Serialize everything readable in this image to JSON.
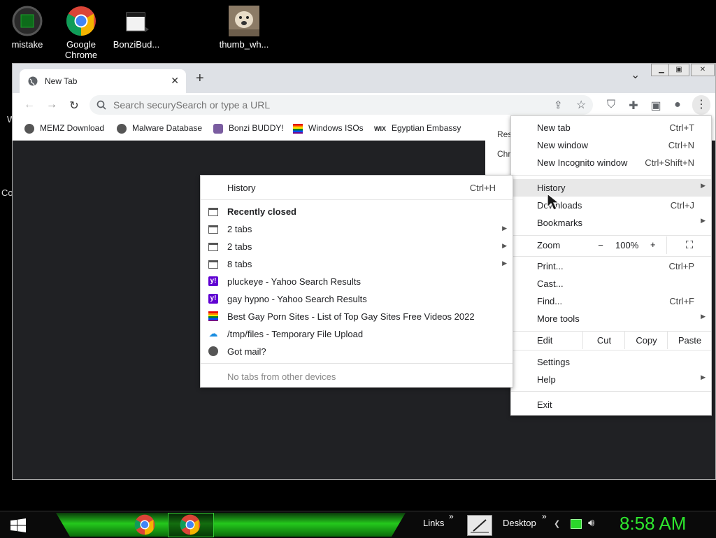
{
  "desktop": {
    "icons": [
      {
        "label": "mistake"
      },
      {
        "label": "Google Chrome"
      },
      {
        "label": "BonziBud..."
      },
      {
        "label": "thumb_wh..."
      }
    ],
    "edge_texts": [
      "W",
      "Co"
    ]
  },
  "browser": {
    "tab_title": "New Tab",
    "close_symbol": "✕",
    "new_tab_symbol": "+",
    "tab_dropdown_symbol": "⌄",
    "omnibox_placeholder": "Search securySearch or type a URL",
    "bookmarks": [
      {
        "label": "MEMZ Download",
        "icon": "globe-icon"
      },
      {
        "label": "Malware Database",
        "icon": "globe-icon"
      },
      {
        "label": "Bonzi BUDDY!",
        "icon": "bonzi-icon"
      },
      {
        "label": "Windows ISOs",
        "icon": "rainbow-icon"
      },
      {
        "label": "Egyptian Embassy",
        "icon": "wix-icon",
        "icon_text": "WIX"
      }
    ],
    "partial_menu": [
      "Res",
      "Chr"
    ]
  },
  "main_menu": {
    "items": [
      {
        "label": "New tab",
        "shortcut": "Ctrl+T"
      },
      {
        "label": "New window",
        "shortcut": "Ctrl+N"
      },
      {
        "label": "New Incognito window",
        "shortcut": "Ctrl+Shift+N"
      },
      {
        "label": "History",
        "shortcut": ""
      },
      {
        "label": "Downloads",
        "shortcut": "Ctrl+J"
      },
      {
        "label": "Bookmarks",
        "shortcut": ""
      },
      {
        "label": "Print...",
        "shortcut": "Ctrl+P"
      },
      {
        "label": "Cast...",
        "shortcut": ""
      },
      {
        "label": "Find...",
        "shortcut": "Ctrl+F"
      },
      {
        "label": "More tools",
        "shortcut": ""
      },
      {
        "label": "Settings",
        "shortcut": ""
      },
      {
        "label": "Help",
        "shortcut": ""
      },
      {
        "label": "Exit",
        "shortcut": ""
      }
    ],
    "zoom": {
      "label": "Zoom",
      "minus": "−",
      "value": "100%",
      "plus": "+"
    },
    "edit": {
      "label": "Edit",
      "cut": "Cut",
      "copy": "Copy",
      "paste": "Paste"
    }
  },
  "history_menu": {
    "header": {
      "label": "History",
      "shortcut": "Ctrl+H"
    },
    "recently_closed": "Recently closed",
    "items": [
      {
        "label": "2 tabs",
        "icon": "tab-group-icon"
      },
      {
        "label": "2 tabs",
        "icon": "tab-group-icon"
      },
      {
        "label": "8 tabs",
        "icon": "tab-group-icon"
      },
      {
        "label": "pluckeye - Yahoo Search Results",
        "icon": "yahoo-icon",
        "icon_text": "y!"
      },
      {
        "label": "gay hypno - Yahoo Search Results",
        "icon": "yahoo-icon",
        "icon_text": "y!"
      },
      {
        "label": "Best Gay Porn Sites - List of Top Gay Sites Free Videos 2022",
        "icon": "rainbow-icon"
      },
      {
        "label": "/tmp/files - Temporary File Upload",
        "icon": "cloud-upload-icon"
      },
      {
        "label": "Got mail?",
        "icon": "globe-icon"
      }
    ],
    "footer": "No tabs from other devices"
  },
  "taskbar": {
    "links_label": "Links",
    "desktop_label": "Desktop",
    "overflow": "»",
    "clock": "8:58 AM"
  }
}
